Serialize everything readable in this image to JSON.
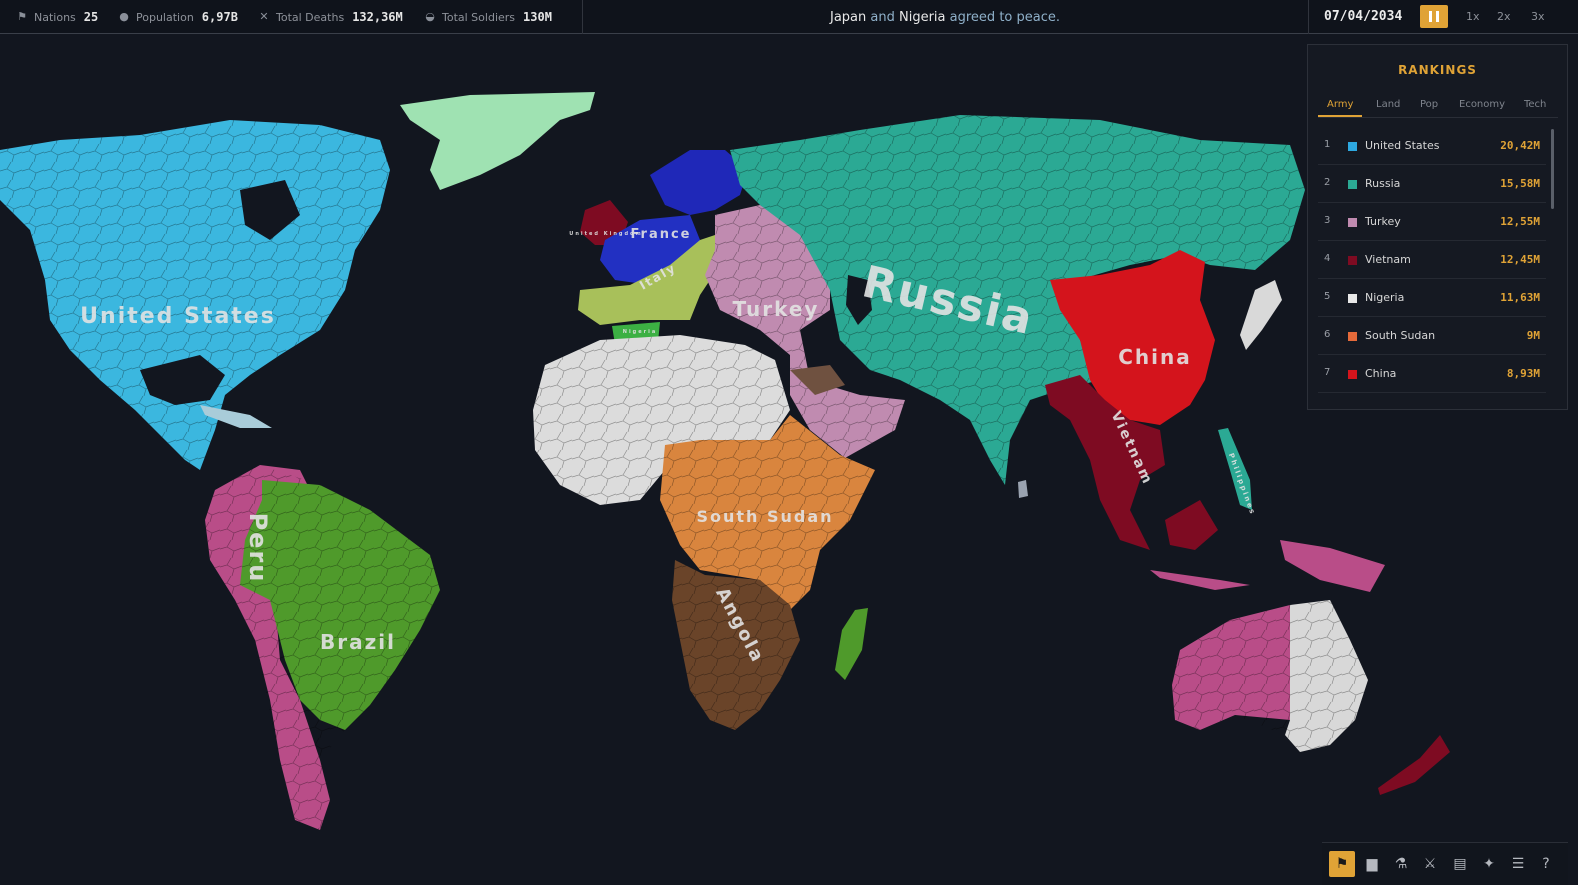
{
  "topbar": {
    "nations": {
      "label": "Nations",
      "value": "25",
      "icon": "flag-icon"
    },
    "population": {
      "label": "Population",
      "value": "6,97B",
      "icon": "people-icon"
    },
    "deaths": {
      "label": "Total Deaths",
      "value": "132,36M",
      "icon": "crossed-swords-icon"
    },
    "soldiers": {
      "label": "Total Soldiers",
      "value": "130M",
      "icon": "helmet-icon"
    },
    "news": {
      "a": "Japan",
      "and": "and",
      "b": "Nigeria",
      "verb": "agreed to peace."
    },
    "date": "07/04/2034",
    "speeds": [
      "1x",
      "2x",
      "3x"
    ]
  },
  "map": {
    "labels": {
      "united_states": "United States",
      "russia": "Russia",
      "china": "China",
      "brazil": "Brazil",
      "peru": "Peru",
      "south_sudan": "South Sudan",
      "angola": "Angola",
      "turkey": "Turkey",
      "vietnam": "Vietnam",
      "france": "France",
      "italy": "Italy",
      "united_kingdom": "United Kingdom",
      "nigeria": "Nigeria",
      "philippines": "Philippines"
    },
    "colors": {
      "united_states": "#3bb7df",
      "russia": "#2ba994",
      "china": "#d4141c",
      "vietnam": "#7e0b22",
      "turkey": "#c08bb0",
      "nigeria": "#dcdcdc",
      "south_sudan": "#d9853e",
      "angola": "#6a4429",
      "brazil": "#4f9a2b",
      "peru": "#b94d88",
      "france": "#2230c2",
      "italy": "#a8c05a",
      "greenland": "#9fe2b2",
      "ocean": "#12161f"
    }
  },
  "rankings": {
    "title": "RANKINGS",
    "tabs": [
      "Army",
      "Land",
      "Pop",
      "Economy",
      "Tech"
    ],
    "active_tab": "Army",
    "rows": [
      {
        "rank": "1",
        "name": "United States",
        "value": "20,42M",
        "color": "#2da8e0"
      },
      {
        "rank": "2",
        "name": "Russia",
        "value": "15,58M",
        "color": "#2ba994"
      },
      {
        "rank": "3",
        "name": "Turkey",
        "value": "12,55M",
        "color": "#c08bb0"
      },
      {
        "rank": "4",
        "name": "Vietnam",
        "value": "12,45M",
        "color": "#7e0b22"
      },
      {
        "rank": "5",
        "name": "Nigeria",
        "value": "11,63M",
        "color": "#e8e8e8"
      },
      {
        "rank": "6",
        "name": "South Sudan",
        "value": "9M",
        "color": "#e56a3a"
      },
      {
        "rank": "7",
        "name": "China",
        "value": "8,93M",
        "color": "#d4141c"
      }
    ]
  },
  "toolbar": {
    "tools": [
      "flag-icon",
      "briefcase-icon",
      "flask-icon",
      "sword-icon",
      "scroll-icon",
      "alliance-icon",
      "menu-icon",
      "help-icon"
    ],
    "active": "flag-icon",
    "help_label": "?"
  }
}
